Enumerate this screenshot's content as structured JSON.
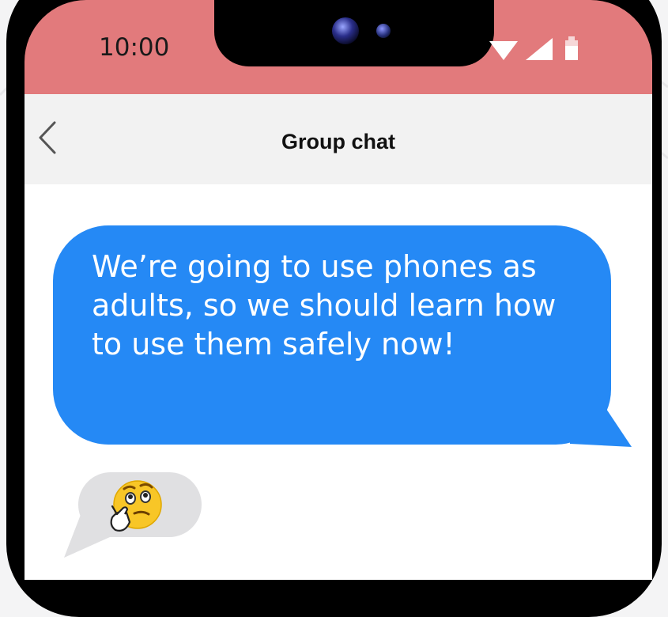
{
  "status_bar": {
    "time": "10:00",
    "icons": [
      "wifi-icon",
      "signal-icon",
      "battery-icon"
    ],
    "color": "#e27a7c"
  },
  "header": {
    "title": "Group chat",
    "back_icon": "chevron-left-icon"
  },
  "messages": [
    {
      "direction": "outgoing",
      "text": "We’re going to use phones as adults, so we should learn how to use them safely now!",
      "bubble_color": "#2589f5"
    },
    {
      "direction": "incoming",
      "emoji": "thinking-face-icon",
      "bubble_color": "#e0e0e2"
    }
  ]
}
